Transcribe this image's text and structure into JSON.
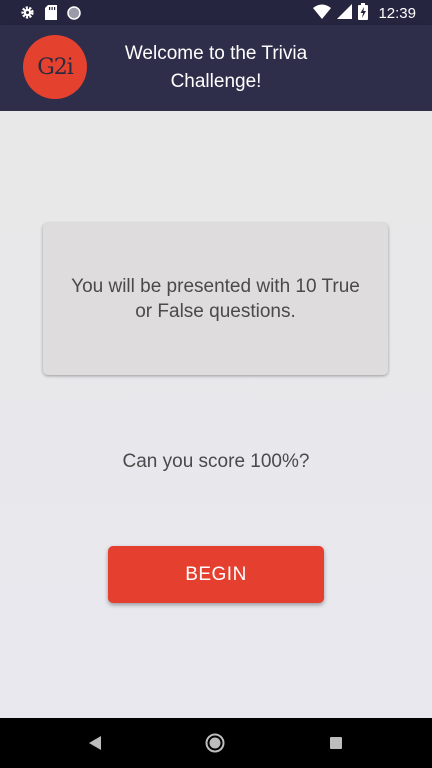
{
  "status_bar": {
    "time": "12:39",
    "battery_level": "charging",
    "icons": [
      "gear-icon",
      "sd-card-icon",
      "circle-icon",
      "wifi-icon",
      "signal-icon",
      "battery-icon"
    ]
  },
  "header": {
    "logo_text": "G2i",
    "title": "Welcome to the Trivia Challenge!"
  },
  "main": {
    "intro_text": "You will be presented with 10 True or False questions.",
    "question_text": "Can you score 100%?",
    "begin_label": "BEGIN"
  },
  "nav": {
    "icons": [
      "back-icon",
      "home-icon",
      "recent-apps-icon"
    ]
  },
  "colors": {
    "header_bg": "#2e2d4a",
    "accent": "#e43f2f",
    "background": "#e9e9eb",
    "card_bg": "#dedcdc"
  }
}
